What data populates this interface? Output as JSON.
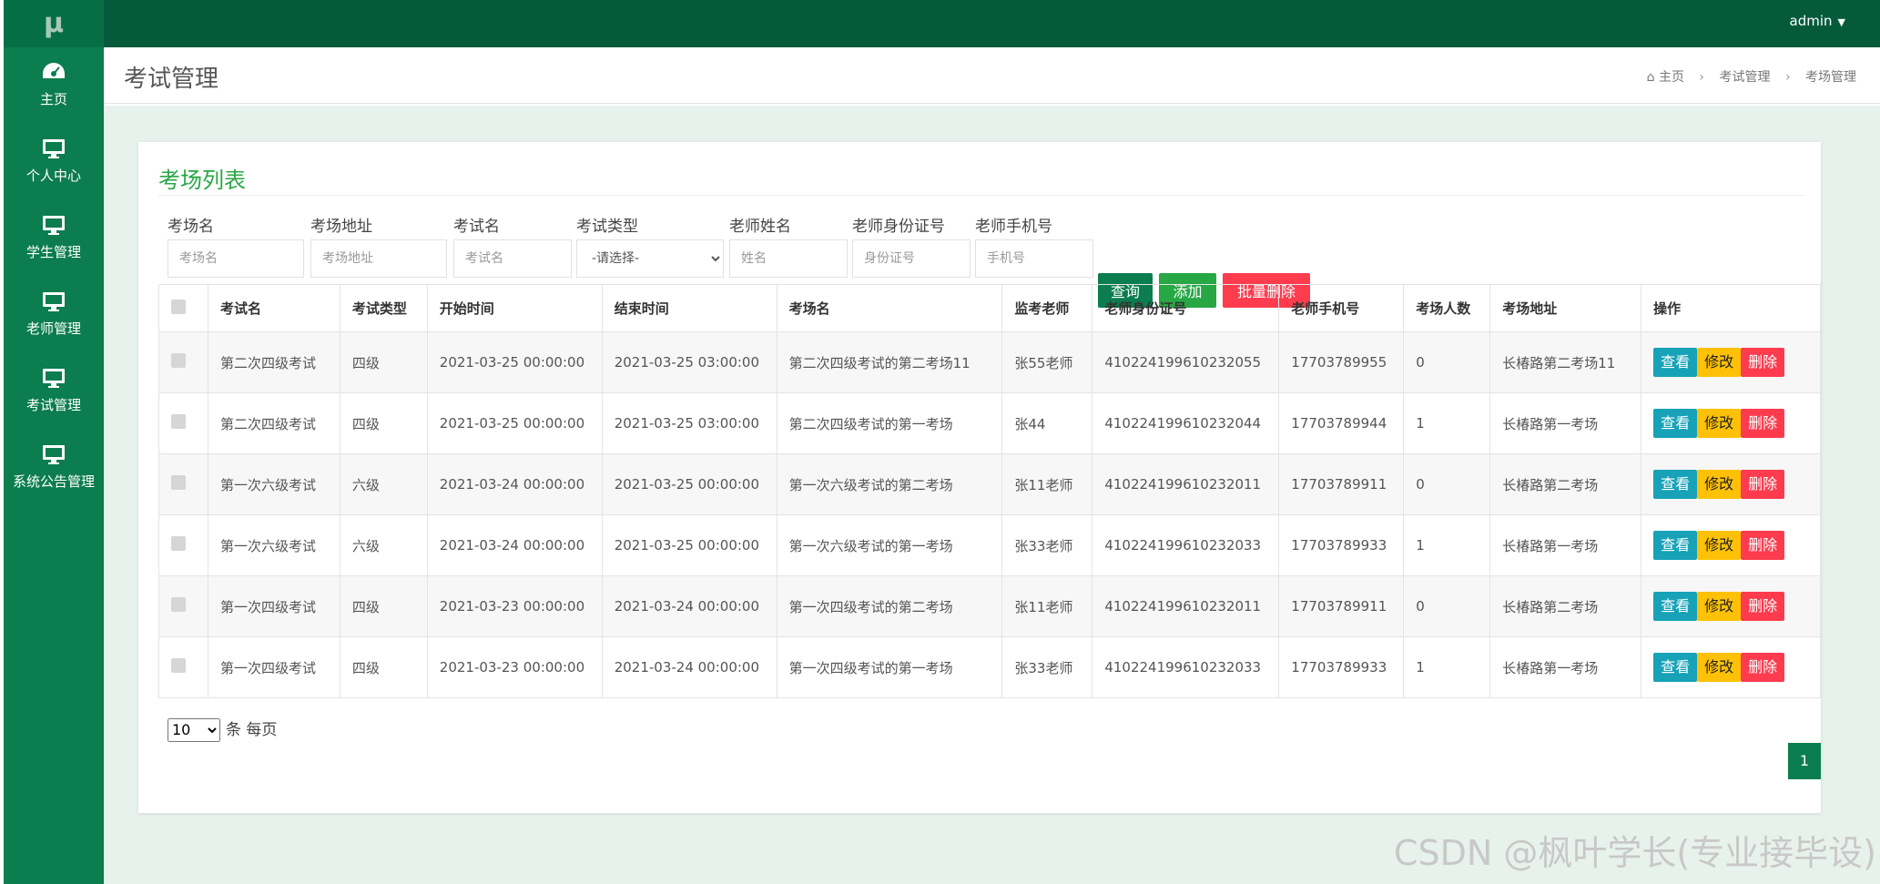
{
  "sidebar": {
    "logo": "μ",
    "items": [
      {
        "label": "主页",
        "icon": "dashboard-icon"
      },
      {
        "label": "个人中心",
        "icon": "monitor-icon"
      },
      {
        "label": "学生管理",
        "icon": "monitor-icon"
      },
      {
        "label": "老师管理",
        "icon": "monitor-icon"
      },
      {
        "label": "考试管理",
        "icon": "monitor-icon"
      },
      {
        "label": "系统公告管理",
        "icon": "monitor-icon"
      }
    ]
  },
  "topbar": {
    "user": "admin"
  },
  "header": {
    "title": "考试管理",
    "breadcrumb": [
      "主页",
      "考试管理",
      "考场管理"
    ]
  },
  "panel": {
    "title": "考场列表",
    "filters": [
      {
        "label": "考场名",
        "placeholder": "考场名"
      },
      {
        "label": "考场地址",
        "placeholder": "考场地址"
      },
      {
        "label": "考试名",
        "placeholder": "考试名"
      },
      {
        "label": "考试类型",
        "selected": "-请选择-"
      },
      {
        "label": "老师姓名",
        "placeholder": "姓名"
      },
      {
        "label": "老师身份证号",
        "placeholder": "身份证号"
      },
      {
        "label": "老师手机号",
        "placeholder": "手机号"
      }
    ],
    "buttons": {
      "query": "查询",
      "add": "添加",
      "batch_delete": "批量删除"
    },
    "table": {
      "headers": [
        "考试名",
        "考试类型",
        "开始时间",
        "结束时间",
        "考场名",
        "监考老师",
        "老师身份证号",
        "老师手机号",
        "考场人数",
        "考场地址",
        "操作"
      ],
      "rows": [
        [
          "第二次四级考试",
          "四级",
          "2021-03-25 00:00:00",
          "2021-03-25 03:00:00",
          "第二次四级考试的第二考场11",
          "张55老师",
          "410224199610232055",
          "17703789955",
          "0",
          "长椿路第二考场11"
        ],
        [
          "第二次四级考试",
          "四级",
          "2021-03-25 00:00:00",
          "2021-03-25 03:00:00",
          "第二次四级考试的第一考场",
          "张44",
          "410224199610232044",
          "17703789944",
          "1",
          "长椿路第一考场"
        ],
        [
          "第一次六级考试",
          "六级",
          "2021-03-24 00:00:00",
          "2021-03-25 00:00:00",
          "第一次六级考试的第二考场",
          "张11老师",
          "410224199610232011",
          "17703789911",
          "0",
          "长椿路第二考场"
        ],
        [
          "第一次六级考试",
          "六级",
          "2021-03-24 00:00:00",
          "2021-03-25 00:00:00",
          "第一次六级考试的第一考场",
          "张33老师",
          "410224199610232033",
          "17703789933",
          "1",
          "长椿路第一考场"
        ],
        [
          "第一次四级考试",
          "四级",
          "2021-03-23 00:00:00",
          "2021-03-24 00:00:00",
          "第一次四级考试的第二考场",
          "张11老师",
          "410224199610232011",
          "17703789911",
          "0",
          "长椿路第二考场"
        ],
        [
          "第一次四级考试",
          "四级",
          "2021-03-23 00:00:00",
          "2021-03-24 00:00:00",
          "第一次四级考试的第一考场",
          "张33老师",
          "410224199610232033",
          "17703789933",
          "1",
          "长椿路第一考场"
        ]
      ],
      "actions": {
        "view": "查看",
        "edit": "修改",
        "delete": "删除"
      }
    },
    "pagination": {
      "page_size": "10",
      "page_size_label": "条 每页",
      "current_page": "1"
    }
  },
  "watermark": "CSDN @枫叶学长(专业接毕设)",
  "colors": {
    "sidebar": "#0b7d4e",
    "topbar": "#055a3c",
    "accent": "#28a745",
    "danger": "#ff3b4e",
    "info": "#17a2b8",
    "warning": "#ffc107"
  }
}
